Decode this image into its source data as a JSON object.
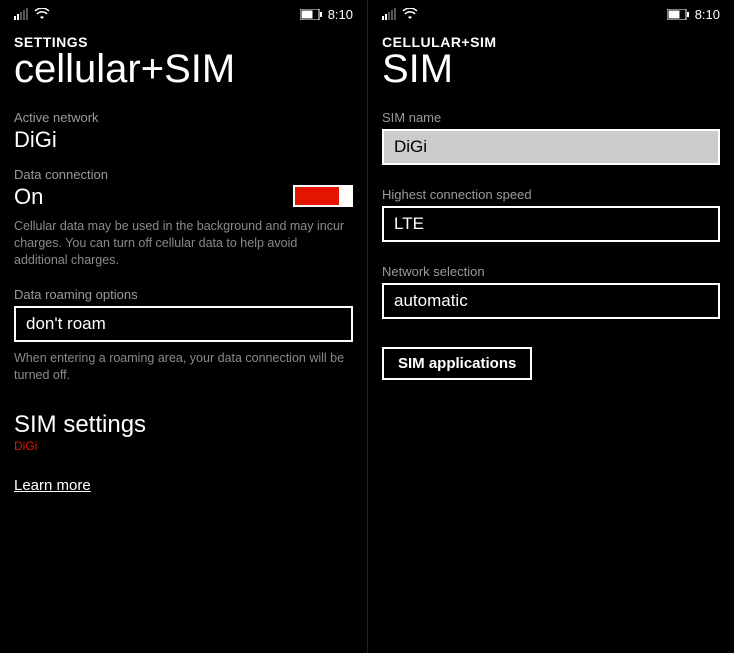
{
  "status": {
    "time": "8:10"
  },
  "left": {
    "breadcrumb": "SETTINGS",
    "title": "cellular+SIM",
    "active_network_label": "Active network",
    "active_network_value": "DiGi",
    "data_conn_label": "Data connection",
    "data_conn_value": "On",
    "data_conn_desc": "Cellular data may be used in the background and may incur charges. You can turn off cellular data to help avoid additional charges.",
    "roaming_label": "Data roaming options",
    "roaming_value": "don't roam",
    "roaming_desc": "When entering a roaming area, your data connection will be turned off.",
    "sim_settings_title": "SIM settings",
    "sim_settings_sub": "DiGi",
    "learn_more": "Learn more"
  },
  "right": {
    "breadcrumb": "CELLULAR+SIM",
    "title": "SIM",
    "sim_name_label": "SIM name",
    "sim_name_value": "DiGi",
    "speed_label": "Highest connection speed",
    "speed_value": "LTE",
    "netsel_label": "Network selection",
    "netsel_value": "automatic",
    "sim_apps_button": "SIM applications"
  }
}
